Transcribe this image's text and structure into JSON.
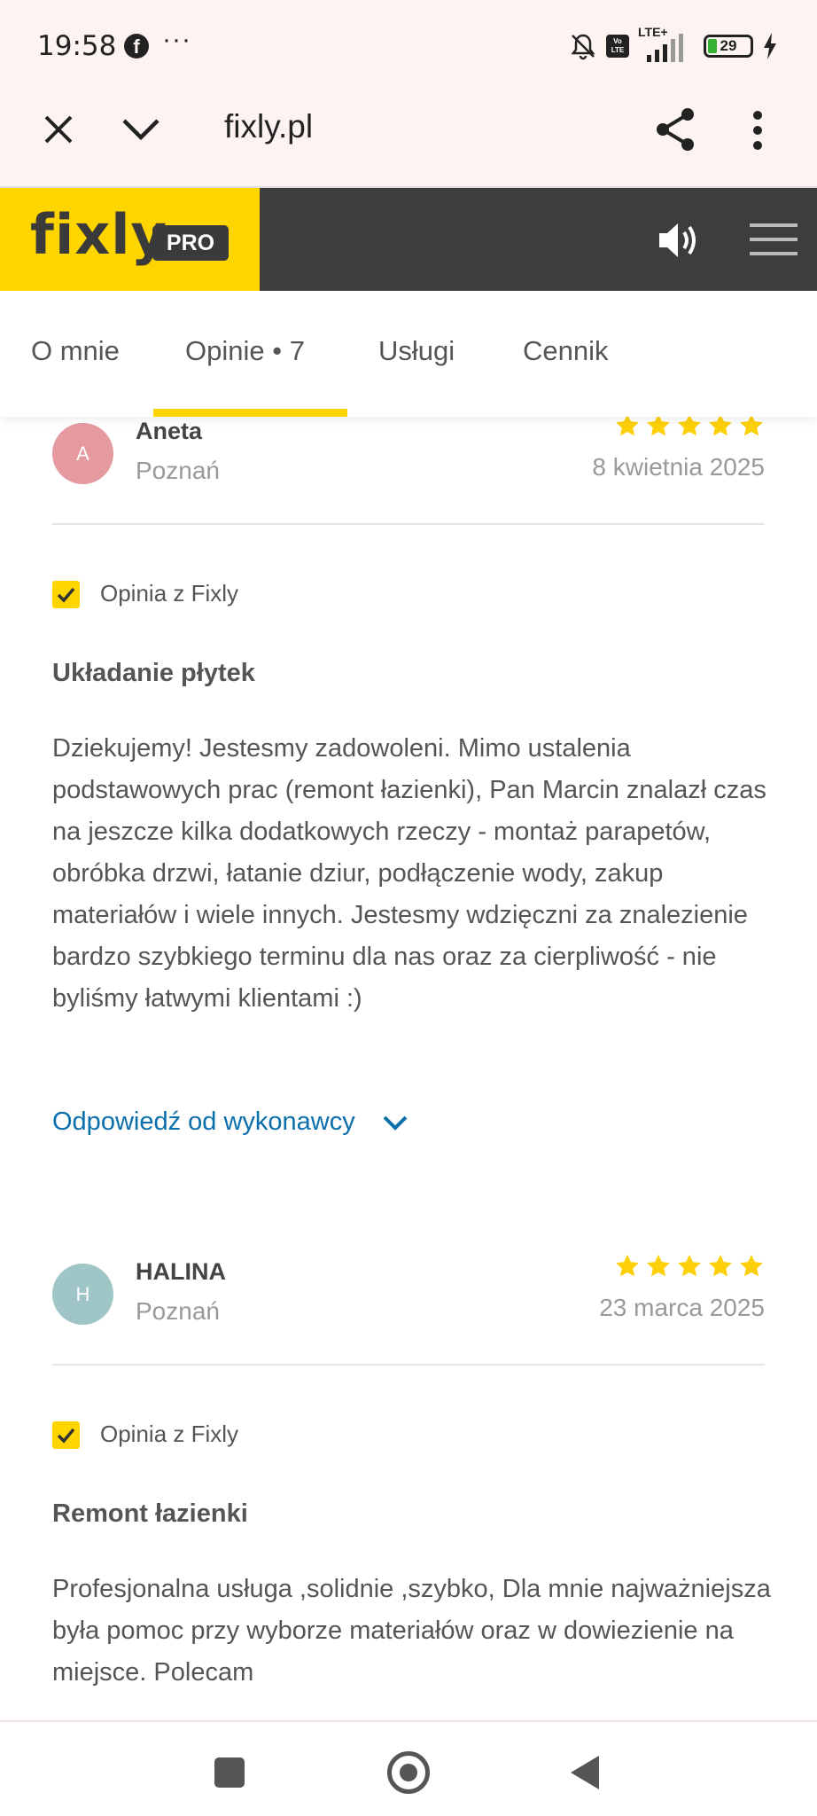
{
  "status_bar": {
    "time": "19:58",
    "more": "···",
    "network": "LTE+",
    "volte": "Vo LTE",
    "battery": "29"
  },
  "browser": {
    "url": "fixly.pl"
  },
  "header": {
    "logo": "fixly",
    "pro_badge": "PRO"
  },
  "tabs": [
    {
      "label": "O mnie"
    },
    {
      "label": "Opinie • 7"
    },
    {
      "label": "Usługi"
    },
    {
      "label": "Cennik"
    }
  ],
  "reviews": [
    {
      "initial": "A",
      "name": "Aneta",
      "city": "Poznań",
      "rating": 5,
      "date": "8 kwietnia 2025",
      "badge": "Opinia z Fixly",
      "title": "Układanie płytek",
      "text": "Dziekujemy! Jestesmy zadowoleni. Mimo ustalenia podstawowych prac (remont łazienki), Pan Marcin znalazł czas na jeszcze kilka dodatkowych rzeczy - montaż parapetów, obróbka drzwi, łatanie dziur, podłączenie wody, zakup materiałów i wiele innych. Jestesmy wdzięczni za znalezienie bardzo szybkiego terminu dla nas oraz za cierpliwość - nie byliśmy łatwymi klientami :)",
      "reply_link": "Odpowiedź od wykonawcy",
      "avatar_color": "#e59aa0"
    },
    {
      "initial": "H",
      "name": "HALINA",
      "city": "Poznań",
      "rating": 5,
      "date": "23 marca 2025",
      "badge": "Opinia z Fixly",
      "title": "Remont łazienki",
      "text": "Profesjonalna usługa ,solidnie ,szybko, Dla mnie najważniejsza była pomoc przy wyborze materiałów oraz w dowiezienie na miejsce. Polecam",
      "avatar_color": "#9fc5c6"
    }
  ],
  "colors": {
    "brand_yellow": "#ffd500",
    "header_dark": "#3d3d3d",
    "link_blue": "#0a6faa",
    "star_yellow": "#fdd00a"
  }
}
